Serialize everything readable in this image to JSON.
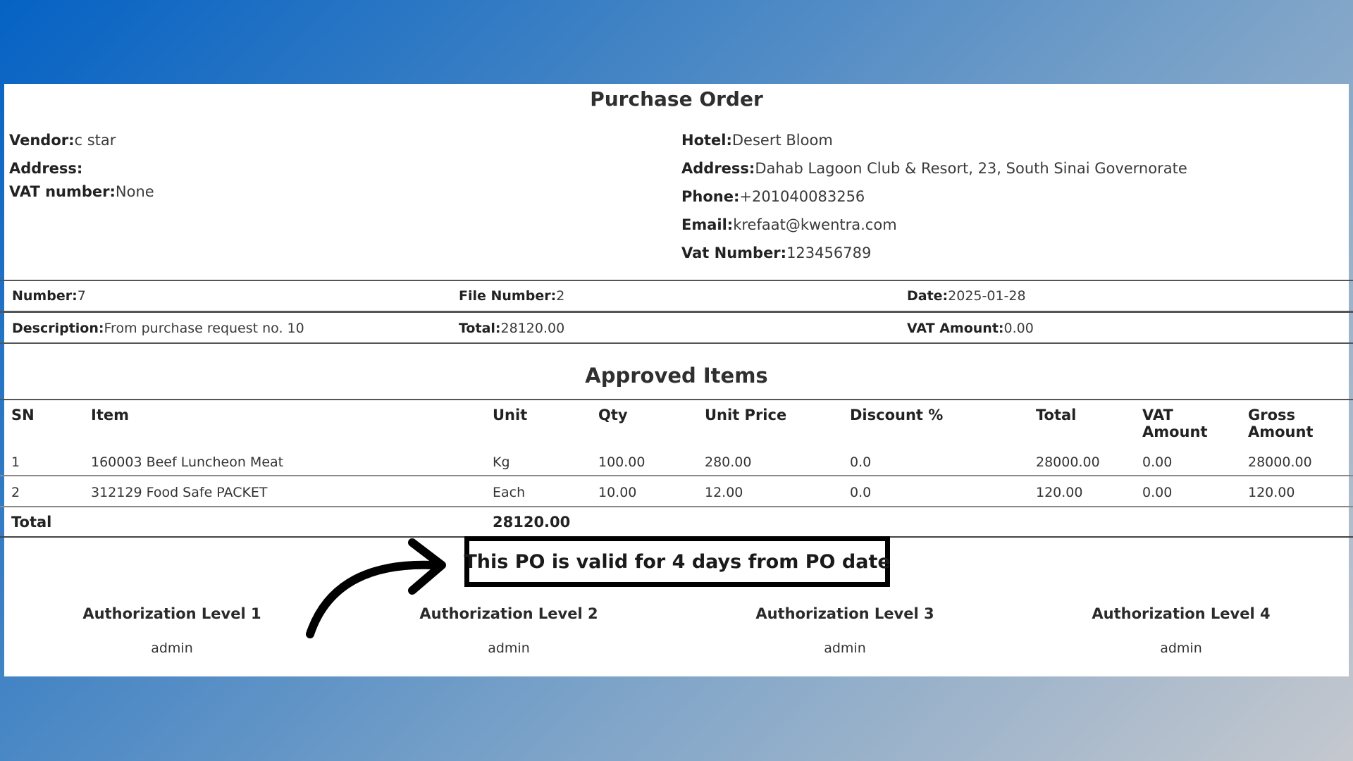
{
  "document": {
    "title": "Purchase Order",
    "vendor": {
      "label": "Vendor:",
      "value": "c star"
    },
    "vendor_address": {
      "label": "Address:",
      "value": ""
    },
    "vendor_vat": {
      "label": "VAT number:",
      "value": "None"
    },
    "hotel": {
      "label": "Hotel:",
      "value": "Desert Bloom"
    },
    "hotel_address": {
      "label": "Address:",
      "value": "Dahab Lagoon Club & Resort, 23, South Sinai Governorate"
    },
    "phone": {
      "label": "Phone:",
      "value": "+201040083256"
    },
    "email": {
      "label": "Email:",
      "value": "krefaat@kwentra.com"
    },
    "vat_number": {
      "label": "Vat Number:",
      "value": "123456789"
    }
  },
  "summary": {
    "number": {
      "label": "Number:",
      "value": "7"
    },
    "file_number": {
      "label": "File Number:",
      "value": "2"
    },
    "date": {
      "label": "Date:",
      "value": "2025-01-28"
    },
    "description": {
      "label": "Description:",
      "value": "From purchase request no. 10"
    },
    "total": {
      "label": "Total:",
      "value": "28120.00"
    },
    "vat_amount": {
      "label": "VAT Amount:",
      "value": "0.00"
    }
  },
  "items_table": {
    "title": "Approved Items",
    "headers": {
      "sn": "SN",
      "item": "Item",
      "unit": "Unit",
      "qty": "Qty",
      "unit_price": "Unit Price",
      "discount": "Discount %",
      "total": "Total",
      "vat_amount_1": "VAT",
      "vat_amount_2": "Amount",
      "gross_amount_1": "Gross",
      "gross_amount_2": "Amount"
    },
    "rows": [
      {
        "sn": "1",
        "item": "160003 Beef Luncheon Meat",
        "unit": "Kg",
        "qty": "100.00",
        "unit_price": "280.00",
        "discount": "0.0",
        "total": "28000.00",
        "vat": "0.00",
        "gross": "28000.00"
      },
      {
        "sn": "2",
        "item": "312129 Food Safe PACKET",
        "unit": "Each",
        "qty": "10.00",
        "unit_price": "12.00",
        "discount": "0.0",
        "total": "120.00",
        "vat": "0.00",
        "gross": "120.00"
      }
    ],
    "footer": {
      "label": "Total",
      "value": "28120.00"
    }
  },
  "callout": {
    "text": "This PO is valid for 4 days from PO date"
  },
  "authorizations": [
    {
      "level": "Authorization Level 1",
      "user": "admin"
    },
    {
      "level": "Authorization Level 2",
      "user": "admin"
    },
    {
      "level": "Authorization Level 3",
      "user": "admin"
    },
    {
      "level": "Authorization Level 4",
      "user": "admin"
    }
  ],
  "colors": {
    "border": "#555555",
    "callout_border": "#000000",
    "background_start": "#0562c4",
    "background_end": "#c5c8ce"
  }
}
